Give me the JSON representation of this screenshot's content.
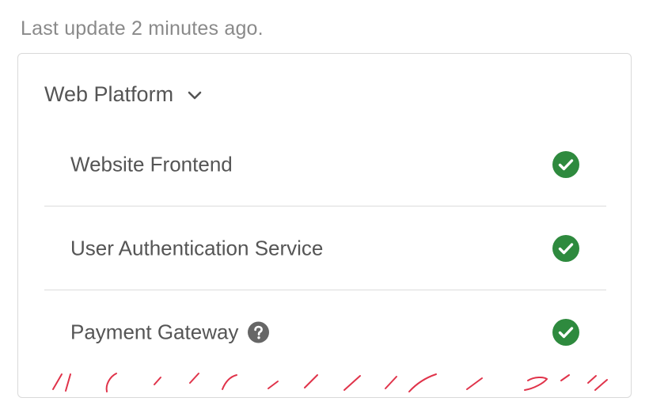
{
  "last_update": "Last update 2 minutes ago.",
  "group": {
    "title": "Web Platform",
    "toggle_icon": "chevron-down-icon"
  },
  "components": [
    {
      "name": "Website Frontend",
      "status": "operational",
      "status_icon": "check-circle-icon",
      "has_help": false
    },
    {
      "name": "User Authentication Service",
      "status": "operational",
      "status_icon": "check-circle-icon",
      "has_help": false
    },
    {
      "name": "Payment Gateway",
      "status": "operational",
      "status_icon": "check-circle-icon",
      "has_help": true,
      "help_icon": "question-circle-icon"
    }
  ],
  "colors": {
    "operational": "#2e8a3e",
    "text": "#555555",
    "muted": "#8a8a8a",
    "annotation": "#e0334a"
  }
}
